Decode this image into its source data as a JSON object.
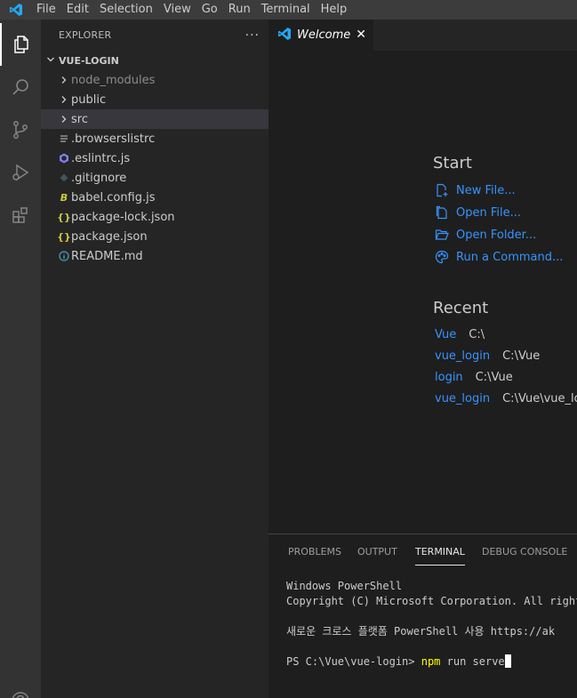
{
  "menu": [
    "File",
    "Edit",
    "Selection",
    "View",
    "Go",
    "Run",
    "Terminal",
    "Help"
  ],
  "sidebar": {
    "title": "EXPLORER",
    "more": "···",
    "folder": "VUE-LOGIN",
    "items": [
      {
        "label": "node_modules",
        "icon": "chevron-right"
      },
      {
        "label": "public",
        "icon": "chevron-right"
      },
      {
        "label": "src",
        "icon": "chevron-right"
      },
      {
        "label": ".browserslistrc",
        "icon": "lines-icon"
      },
      {
        "label": ".eslintrc.js",
        "icon": "eslint-icon"
      },
      {
        "label": ".gitignore",
        "icon": "git-icon"
      },
      {
        "label": "babel.config.js",
        "icon": "babel-icon"
      },
      {
        "label": "package-lock.json",
        "icon": "json-icon"
      },
      {
        "label": "package.json",
        "icon": "json-icon"
      },
      {
        "label": "README.md",
        "icon": "info-icon"
      }
    ]
  },
  "tab": {
    "label": "Welcome",
    "close": "✕"
  },
  "welcome": {
    "start_title": "Start",
    "start_links": [
      "New File...",
      "Open File...",
      "Open Folder...",
      "Run a Command..."
    ],
    "recent_title": "Recent",
    "recent": [
      {
        "name": "Vue",
        "path": "C:\\"
      },
      {
        "name": "vue_login",
        "path": "C:\\Vue"
      },
      {
        "name": "login",
        "path": "C:\\Vue"
      },
      {
        "name": "vue_login",
        "path": "C:\\Vue\\vue_logi"
      }
    ]
  },
  "panel": {
    "tabs": [
      "PROBLEMS",
      "OUTPUT",
      "TERMINAL",
      "DEBUG CONSOLE"
    ],
    "active_tab": "TERMINAL",
    "terminal": {
      "line1": "Windows PowerShell",
      "line2": "Copyright (C) Microsoft Corporation. All rights",
      "line3": "새로운 크로스 플랫폼 PowerShell 사용 https://ak",
      "prompt": "PS C:\\Vue\\vue-login> ",
      "cmd_keyword": "npm",
      "cmd_rest": " run serve"
    }
  },
  "colors": {
    "accent": "#3794ff",
    "vscode_blue": "#23a9f2",
    "json": "#cbcb41"
  }
}
